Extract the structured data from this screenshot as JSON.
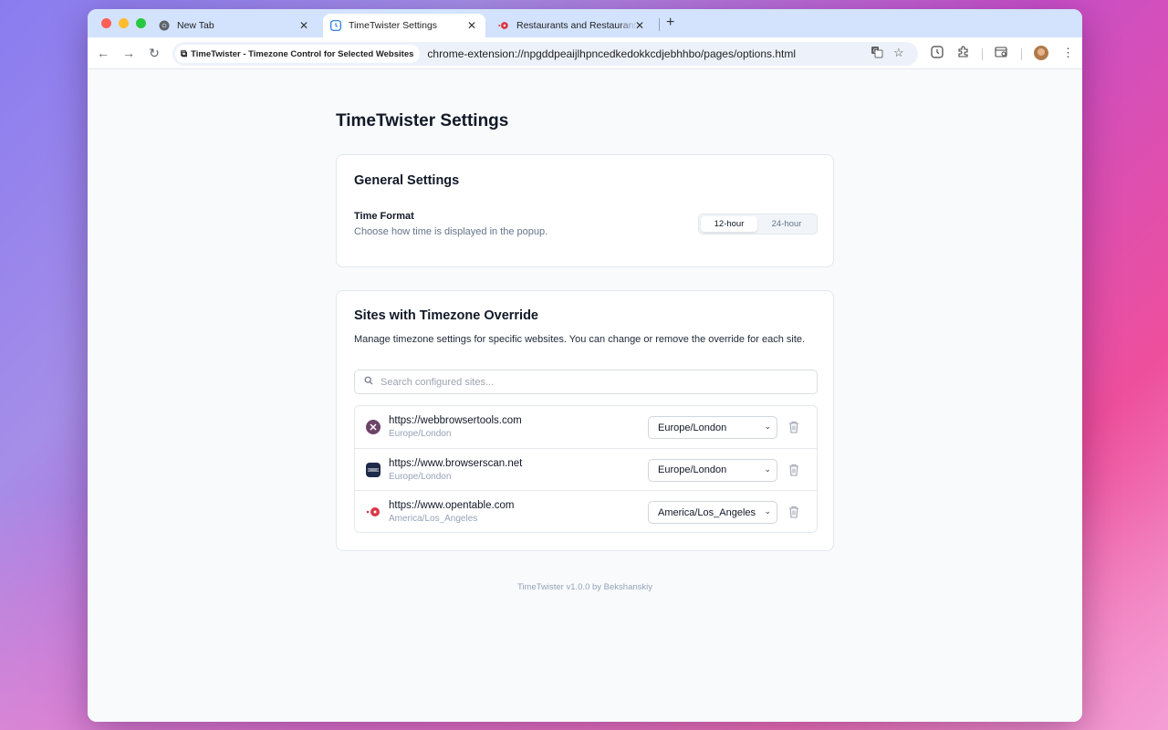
{
  "colors": {
    "tabbar_bg": "#d3e3fd",
    "page_bg": "#f8fafc",
    "title_text": "#111827",
    "muted_text": "#64748b",
    "opentable_red": "#da3743"
  },
  "browser": {
    "tabs": [
      {
        "title": "New Tab",
        "icon": "chrome-icon"
      },
      {
        "title": "TimeTwister Settings",
        "icon": "clock-icon",
        "active": true
      },
      {
        "title": "Restaurants and Restaurant B",
        "icon": "opentable-icon"
      }
    ],
    "extension_chip": "TimeTwister - Timezone Control for Selected Websites",
    "url": "chrome-extension://npgddpeaijlhpncedkedokkcdjebhhbo/pages/options.html"
  },
  "page": {
    "title": "TimeTwister Settings",
    "general": {
      "heading": "General Settings",
      "time_format_label": "Time Format",
      "time_format_desc": "Choose how time is displayed in the popup.",
      "options": [
        "12-hour",
        "24-hour"
      ],
      "selected": "12-hour"
    },
    "sites": {
      "heading": "Sites with Timezone Override",
      "description": "Manage timezone settings for specific websites. You can change or remove the override for each site.",
      "search_placeholder": "Search configured sites...",
      "items": [
        {
          "url": "https://webbrowsertools.com",
          "timezone": "Europe/London",
          "selected": "Europe/London",
          "icon": "webbrowsertools-icon"
        },
        {
          "url": "https://www.browserscan.net",
          "timezone": "Europe/London",
          "selected": "Europe/London",
          "icon": "browserscan-icon"
        },
        {
          "url": "https://www.opentable.com",
          "timezone": "America/Los_Angeles",
          "selected": "America/Los_Angeles",
          "icon": "opentable-icon"
        }
      ]
    },
    "footer": "TimeTwister v1.0.0 by Bekshanskiy"
  }
}
